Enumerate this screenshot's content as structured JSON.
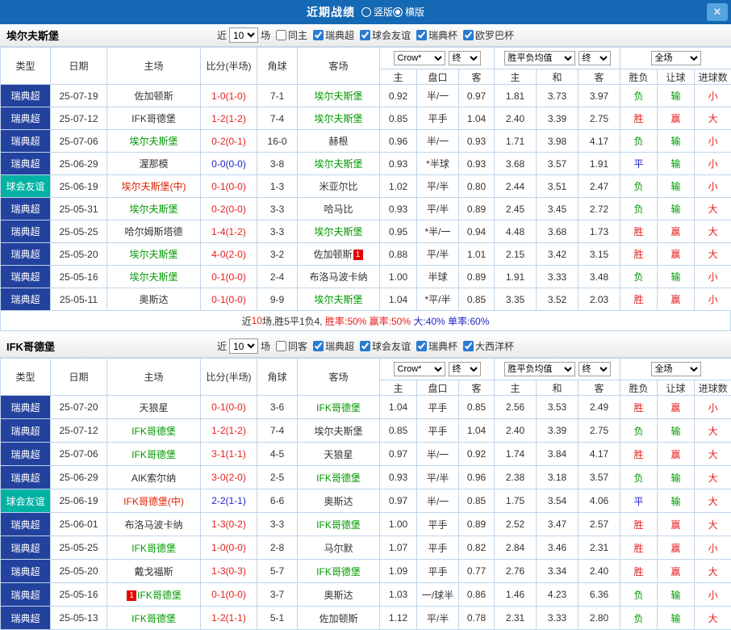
{
  "colors": {
    "topbar_blue": "#1568b3",
    "league_super_bg": "#23429e",
    "league_friendly_bg": "#00b2a4",
    "win_red": "#e51e1e",
    "lose_green": "#009900",
    "draw_blue": "#2222cc",
    "focal_team_green": "#009900",
    "neutral_team_red": "#dd2200"
  },
  "topbar": {
    "title": "近期战绩",
    "layout_options": [
      {
        "label": "竖版",
        "selected": false
      },
      {
        "label": "横版",
        "selected": true
      }
    ],
    "close": "✕"
  },
  "headers": {
    "type": "类型",
    "date": "日期",
    "home": "主场",
    "score": "比分(半场)",
    "corners": "角球",
    "away": "客场",
    "asia_company": "Crow*",
    "asia_final": "终",
    "europe_avg": "胜平负均值",
    "europe_final": "终",
    "scope": "全场",
    "asia_sub": [
      "主",
      "盘口",
      "客"
    ],
    "europe_sub": [
      "主",
      "和",
      "客"
    ],
    "result_sub": [
      "胜负",
      "让球",
      "进球数"
    ]
  },
  "sections": [
    {
      "team": "埃尔夫斯堡",
      "filter": {
        "near": "近",
        "count": "10",
        "games": "场",
        "venue": {
          "label": "同主",
          "checked": false
        },
        "leagues": [
          {
            "label": "瑞典超",
            "checked": true
          },
          {
            "label": "球会友谊",
            "checked": true
          },
          {
            "label": "瑞典杯",
            "checked": true
          },
          {
            "label": "欧罗巴杯",
            "checked": true
          }
        ]
      },
      "rows": [
        {
          "lt": "super",
          "type": "瑞典超",
          "date": "25-07-19",
          "home": "佐加顿斯",
          "hs": "n",
          "score": "1-0(1-0)",
          "sc": "w",
          "corners": "7-1",
          "away": "埃尔夫斯堡",
          "as": "f",
          "asia": [
            "0.92",
            "半/一",
            "0.97"
          ],
          "europe": [
            "1.81",
            "3.73",
            "3.97"
          ],
          "r1": [
            "负",
            "l"
          ],
          "r2": [
            "输",
            "l"
          ],
          "r3": [
            "小",
            "w"
          ]
        },
        {
          "lt": "super",
          "type": "瑞典超",
          "date": "25-07-12",
          "home": "IFK哥德堡",
          "hs": "n",
          "score": "1-2(1-2)",
          "sc": "w",
          "corners": "7-4",
          "away": "埃尔夫斯堡",
          "as": "f",
          "asia": [
            "0.85",
            "平手",
            "1.04"
          ],
          "europe": [
            "2.40",
            "3.39",
            "2.75"
          ],
          "r1": [
            "胜",
            "w"
          ],
          "r2": [
            "赢",
            "w"
          ],
          "r3": [
            "大",
            "w"
          ]
        },
        {
          "lt": "super",
          "type": "瑞典超",
          "date": "25-07-06",
          "home": "埃尔夫斯堡",
          "hs": "f",
          "score": "0-2(0-1)",
          "sc": "w",
          "corners": "16-0",
          "away": "赫根",
          "as": "n",
          "asia": [
            "0.96",
            "半/一",
            "0.93"
          ],
          "europe": [
            "1.71",
            "3.98",
            "4.17"
          ],
          "r1": [
            "负",
            "l"
          ],
          "r2": [
            "输",
            "l"
          ],
          "r3": [
            "小",
            "w"
          ]
        },
        {
          "lt": "super",
          "type": "瑞典超",
          "date": "25-06-29",
          "home": "渥那模",
          "hs": "n",
          "score": "0-0(0-0)",
          "sc": "d",
          "corners": "3-8",
          "away": "埃尔夫斯堡",
          "as": "f",
          "asia": [
            "0.93",
            "*半球",
            "0.93"
          ],
          "europe": [
            "3.68",
            "3.57",
            "1.91"
          ],
          "r1": [
            "平",
            "d"
          ],
          "r2": [
            "输",
            "l"
          ],
          "r3": [
            "小",
            "w"
          ]
        },
        {
          "lt": "friendly",
          "type": "球会友谊",
          "date": "25-06-19",
          "home": "埃尔夫斯堡(中)",
          "hs": "fr",
          "score": "0-1(0-0)",
          "sc": "w",
          "corners": "1-3",
          "away": "米亚尔比",
          "as": "n",
          "asia": [
            "1.02",
            "平/半",
            "0.80"
          ],
          "europe": [
            "2.44",
            "3.51",
            "2.47"
          ],
          "r1": [
            "负",
            "l"
          ],
          "r2": [
            "输",
            "l"
          ],
          "r3": [
            "小",
            "w"
          ]
        },
        {
          "lt": "super",
          "type": "瑞典超",
          "date": "25-05-31",
          "home": "埃尔夫斯堡",
          "hs": "f",
          "score": "0-2(0-0)",
          "sc": "w",
          "corners": "3-3",
          "away": "哈马比",
          "as": "n",
          "asia": [
            "0.93",
            "平/半",
            "0.89"
          ],
          "europe": [
            "2.45",
            "3.45",
            "2.72"
          ],
          "r1": [
            "负",
            "l"
          ],
          "r2": [
            "输",
            "l"
          ],
          "r3": [
            "大",
            "w"
          ]
        },
        {
          "lt": "super",
          "type": "瑞典超",
          "date": "25-05-25",
          "home": "哈尔姆斯塔德",
          "hs": "n",
          "score": "1-4(1-2)",
          "sc": "w",
          "corners": "3-3",
          "away": "埃尔夫斯堡",
          "as": "f",
          "asia": [
            "0.95",
            "*半/一",
            "0.94"
          ],
          "europe": [
            "4.48",
            "3.68",
            "1.73"
          ],
          "r1": [
            "胜",
            "w"
          ],
          "r2": [
            "赢",
            "w"
          ],
          "r3": [
            "大",
            "w"
          ]
        },
        {
          "lt": "super",
          "type": "瑞典超",
          "date": "25-05-20",
          "home": "埃尔夫斯堡",
          "hs": "f",
          "score": "4-0(2-0)",
          "sc": "w",
          "corners": "3-2",
          "away": "佐加顿斯",
          "as": "n",
          "acard": "1",
          "acard_pos": "after",
          "asia": [
            "0.88",
            "平/半",
            "1.01"
          ],
          "europe": [
            "2.15",
            "3.42",
            "3.15"
          ],
          "r1": [
            "胜",
            "w"
          ],
          "r2": [
            "赢",
            "w"
          ],
          "r3": [
            "大",
            "w"
          ]
        },
        {
          "lt": "super",
          "type": "瑞典超",
          "date": "25-05-16",
          "home": "埃尔夫斯堡",
          "hs": "f",
          "score": "0-1(0-0)",
          "sc": "w",
          "corners": "2-4",
          "away": "布洛马波卡纳",
          "as": "n",
          "asia": [
            "1.00",
            "半球",
            "0.89"
          ],
          "europe": [
            "1.91",
            "3.33",
            "3.48"
          ],
          "r1": [
            "负",
            "l"
          ],
          "r2": [
            "输",
            "l"
          ],
          "r3": [
            "小",
            "w"
          ]
        },
        {
          "lt": "super",
          "type": "瑞典超",
          "date": "25-05-11",
          "home": "奥斯达",
          "hs": "n",
          "score": "0-1(0-0)",
          "sc": "w",
          "corners": "9-9",
          "away": "埃尔夫斯堡",
          "as": "f",
          "asia": [
            "1.04",
            "*平/半",
            "0.85"
          ],
          "europe": [
            "3.35",
            "3.52",
            "2.03"
          ],
          "r1": [
            "胜",
            "w"
          ],
          "r2": [
            "赢",
            "w"
          ],
          "r3": [
            "小",
            "w"
          ]
        }
      ],
      "summary": [
        {
          "text": "近",
          "c": "dark"
        },
        {
          "text": "10",
          "c": "red"
        },
        {
          "text": "场,胜5平1负4, ",
          "c": "dark"
        },
        {
          "text": "胜率:50%",
          "c": "red"
        },
        {
          "text": " 赢率:50%",
          "c": "red"
        },
        {
          "text": " 大:40%",
          "c": "blue"
        },
        {
          "text": " 单率:60%",
          "c": "blue"
        }
      ]
    },
    {
      "team": "IFK哥德堡",
      "filter": {
        "near": "近",
        "count": "10",
        "games": "场",
        "venue": {
          "label": "同客",
          "checked": false
        },
        "leagues": [
          {
            "label": "瑞典超",
            "checked": true
          },
          {
            "label": "球会友谊",
            "checked": true
          },
          {
            "label": "瑞典杯",
            "checked": true
          },
          {
            "label": "大西洋杯",
            "checked": true
          }
        ]
      },
      "rows": [
        {
          "lt": "super",
          "type": "瑞典超",
          "date": "25-07-20",
          "home": "天狼星",
          "hs": "n",
          "score": "0-1(0-0)",
          "sc": "w",
          "corners": "3-6",
          "away": "IFK哥德堡",
          "as": "f",
          "asia": [
            "1.04",
            "平手",
            "0.85"
          ],
          "europe": [
            "2.56",
            "3.53",
            "2.49"
          ],
          "r1": [
            "胜",
            "w"
          ],
          "r2": [
            "赢",
            "w"
          ],
          "r3": [
            "小",
            "w"
          ]
        },
        {
          "lt": "super",
          "type": "瑞典超",
          "date": "25-07-12",
          "home": "IFK哥德堡",
          "hs": "f",
          "score": "1-2(1-2)",
          "sc": "w",
          "corners": "7-4",
          "away": "埃尔夫斯堡",
          "as": "n",
          "asia": [
            "0.85",
            "平手",
            "1.04"
          ],
          "europe": [
            "2.40",
            "3.39",
            "2.75"
          ],
          "r1": [
            "负",
            "l"
          ],
          "r2": [
            "输",
            "l"
          ],
          "r3": [
            "大",
            "w"
          ]
        },
        {
          "lt": "super",
          "type": "瑞典超",
          "date": "25-07-06",
          "home": "IFK哥德堡",
          "hs": "f",
          "score": "3-1(1-1)",
          "sc": "w",
          "corners": "4-5",
          "away": "天狼星",
          "as": "n",
          "asia": [
            "0.97",
            "半/一",
            "0.92"
          ],
          "europe": [
            "1.74",
            "3.84",
            "4.17"
          ],
          "r1": [
            "胜",
            "w"
          ],
          "r2": [
            "赢",
            "w"
          ],
          "r3": [
            "大",
            "w"
          ]
        },
        {
          "lt": "super",
          "type": "瑞典超",
          "date": "25-06-29",
          "home": "AIK索尔纳",
          "hs": "n",
          "score": "3-0(2-0)",
          "sc": "w",
          "corners": "2-5",
          "away": "IFK哥德堡",
          "as": "f",
          "asia": [
            "0.93",
            "平/半",
            "0.96"
          ],
          "europe": [
            "2.38",
            "3.18",
            "3.57"
          ],
          "r1": [
            "负",
            "l"
          ],
          "r2": [
            "输",
            "l"
          ],
          "r3": [
            "大",
            "w"
          ]
        },
        {
          "lt": "friendly",
          "type": "球会友谊",
          "date": "25-06-19",
          "home": "IFK哥德堡(中)",
          "hs": "fr",
          "score": "2-2(1-1)",
          "sc": "d",
          "corners": "6-6",
          "away": "奥斯达",
          "as": "n",
          "asia": [
            "0.97",
            "半/一",
            "0.85"
          ],
          "europe": [
            "1.75",
            "3.54",
            "4.06"
          ],
          "r1": [
            "平",
            "d"
          ],
          "r2": [
            "输",
            "l"
          ],
          "r3": [
            "大",
            "w"
          ]
        },
        {
          "lt": "super",
          "type": "瑞典超",
          "date": "25-06-01",
          "home": "布洛马波卡纳",
          "hs": "n",
          "score": "1-3(0-2)",
          "sc": "w",
          "corners": "3-3",
          "away": "IFK哥德堡",
          "as": "f",
          "asia": [
            "1.00",
            "平手",
            "0.89"
          ],
          "europe": [
            "2.52",
            "3.47",
            "2.57"
          ],
          "r1": [
            "胜",
            "w"
          ],
          "r2": [
            "赢",
            "w"
          ],
          "r3": [
            "大",
            "w"
          ]
        },
        {
          "lt": "super",
          "type": "瑞典超",
          "date": "25-05-25",
          "home": "IFK哥德堡",
          "hs": "f",
          "score": "1-0(0-0)",
          "sc": "w",
          "corners": "2-8",
          "away": "马尔默",
          "as": "n",
          "asia": [
            "1.07",
            "平手",
            "0.82"
          ],
          "europe": [
            "2.84",
            "3.46",
            "2.31"
          ],
          "r1": [
            "胜",
            "w"
          ],
          "r2": [
            "赢",
            "w"
          ],
          "r3": [
            "小",
            "w"
          ]
        },
        {
          "lt": "super",
          "type": "瑞典超",
          "date": "25-05-20",
          "home": "戴戈福斯",
          "hs": "n",
          "score": "1-3(0-3)",
          "sc": "w",
          "corners": "5-7",
          "away": "IFK哥德堡",
          "as": "f",
          "asia": [
            "1.09",
            "平手",
            "0.77"
          ],
          "europe": [
            "2.76",
            "3.34",
            "2.40"
          ],
          "r1": [
            "胜",
            "w"
          ],
          "r2": [
            "赢",
            "w"
          ],
          "r3": [
            "大",
            "w"
          ]
        },
        {
          "lt": "super",
          "type": "瑞典超",
          "date": "25-05-16",
          "home": "IFK哥德堡",
          "hs": "f",
          "hcard": "1",
          "hcard_pos": "before",
          "score": "0-1(0-0)",
          "sc": "w",
          "corners": "3-7",
          "away": "奥斯达",
          "as": "n",
          "asia": [
            "1.03",
            "一/球半",
            "0.86"
          ],
          "europe": [
            "1.46",
            "4.23",
            "6.36"
          ],
          "r1": [
            "负",
            "l"
          ],
          "r2": [
            "输",
            "l"
          ],
          "r3": [
            "小",
            "w"
          ]
        },
        {
          "lt": "super",
          "type": "瑞典超",
          "date": "25-05-13",
          "home": "IFK哥德堡",
          "hs": "f",
          "score": "1-2(1-1)",
          "sc": "w",
          "corners": "5-1",
          "away": "佐加顿斯",
          "as": "n",
          "asia": [
            "1.12",
            "平/半",
            "0.78"
          ],
          "europe": [
            "2.31",
            "3.33",
            "2.80"
          ],
          "r1": [
            "负",
            "l"
          ],
          "r2": [
            "输",
            "l"
          ],
          "r3": [
            "大",
            "w"
          ]
        }
      ]
    }
  ]
}
